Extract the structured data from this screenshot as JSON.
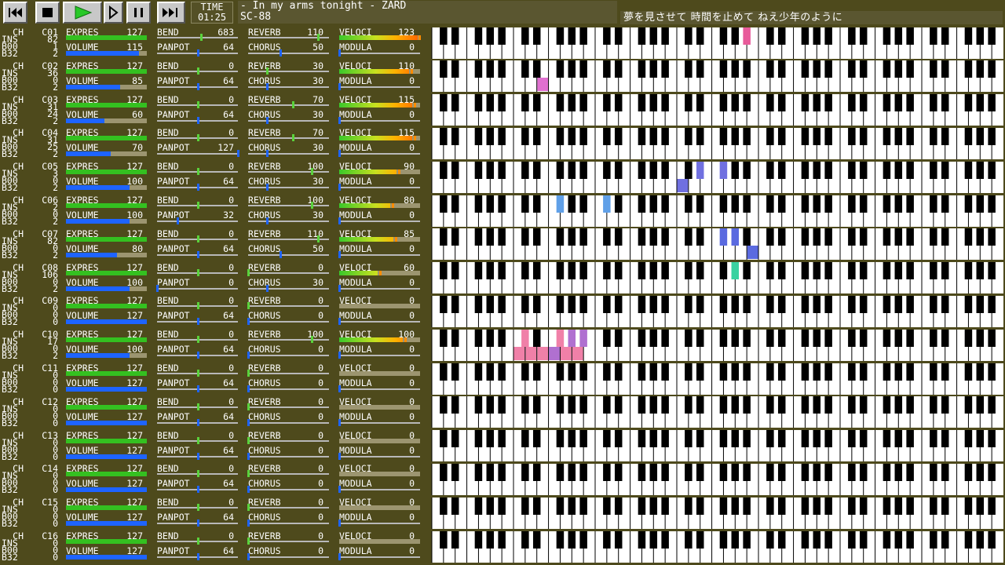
{
  "transport": {
    "buttons": [
      {
        "name": "rewind-button",
        "icon": "skip-back-icon"
      },
      {
        "name": "stop-button",
        "icon": "stop-icon"
      },
      {
        "name": "play-button",
        "icon": "play-icon"
      },
      {
        "name": "step-forward-button",
        "icon": "step-forward-icon"
      },
      {
        "name": "pause-button",
        "icon": "pause-icon"
      },
      {
        "name": "fast-forward-button",
        "icon": "skip-forward-icon"
      }
    ],
    "time_label": "TIME",
    "time_value": "01:25"
  },
  "song": {
    "title": "- In my arms tonight - ZARD",
    "module": "SC-88"
  },
  "lyric": "夢を見させて 時間を止めて ねえ少年のように",
  "labels": {
    "ch": "CH",
    "ins": "INS",
    "b00": "B00",
    "b32": "B32",
    "expres": "EXPRES",
    "volume": "VOLUME",
    "bend": "BEND",
    "panpot": "PANPOT",
    "reverb": "REVERB",
    "chorus": "CHORUS",
    "veloci": "VELOCI",
    "modula": "MODULA"
  },
  "colors": {
    "background": "#4e4a1c",
    "expression_bar": "#34c020",
    "volume_bar": "#1e64ff",
    "slider_thumb": "#5ad23c",
    "slider_thumb_blue": "#1e64ff"
  },
  "channels": [
    {
      "id": "C01",
      "ins": "82",
      "b00": "1",
      "b32": "2",
      "expres": "127",
      "volume": "115",
      "bend": "683",
      "panpot": "64",
      "reverb": "110",
      "chorus": "50",
      "veloci": "123",
      "modula": "0"
    },
    {
      "id": "C02",
      "ins": "36",
      "b00": "0",
      "b32": "2",
      "expres": "127",
      "volume": "85",
      "bend": "0",
      "panpot": "64",
      "reverb": "30",
      "chorus": "30",
      "veloci": "110",
      "modula": "0"
    },
    {
      "id": "C03",
      "ins": "31",
      "b00": "24",
      "b32": "2",
      "expres": "127",
      "volume": "60",
      "bend": "0",
      "panpot": "64",
      "reverb": "70",
      "chorus": "30",
      "veloci": "115",
      "modula": "0"
    },
    {
      "id": "C04",
      "ins": "31",
      "b00": "25",
      "b32": "2",
      "expres": "127",
      "volume": "70",
      "bend": "0",
      "panpot": "127",
      "reverb": "70",
      "chorus": "30",
      "veloci": "115",
      "modula": "0"
    },
    {
      "id": "C05",
      "ins": "3",
      "b00": "0",
      "b32": "2",
      "expres": "127",
      "volume": "100",
      "bend": "0",
      "panpot": "64",
      "reverb": "100",
      "chorus": "30",
      "veloci": "90",
      "modula": "0"
    },
    {
      "id": "C06",
      "ins": "2",
      "b00": "0",
      "b32": "2",
      "expres": "127",
      "volume": "100",
      "bend": "0",
      "panpot": "32",
      "reverb": "100",
      "chorus": "30",
      "veloci": "80",
      "modula": "0"
    },
    {
      "id": "C07",
      "ins": "82",
      "b00": "0",
      "b32": "2",
      "expres": "127",
      "volume": "80",
      "bend": "0",
      "panpot": "64",
      "reverb": "110",
      "chorus": "50",
      "veloci": "85",
      "modula": "0"
    },
    {
      "id": "C08",
      "ins": "106",
      "b00": "0",
      "b32": "2",
      "expres": "127",
      "volume": "100",
      "bend": "0",
      "panpot": "0",
      "reverb": "0",
      "chorus": "30",
      "veloci": "60",
      "modula": "0"
    },
    {
      "id": "C09",
      "ins": "0",
      "b00": "0",
      "b32": "0",
      "expres": "127",
      "volume": "127",
      "bend": "0",
      "panpot": "64",
      "reverb": "0",
      "chorus": "0",
      "veloci": "0",
      "modula": "0"
    },
    {
      "id": "C10",
      "ins": "17",
      "b00": "0",
      "b32": "2",
      "expres": "127",
      "volume": "100",
      "bend": "0",
      "panpot": "64",
      "reverb": "100",
      "chorus": "0",
      "veloci": "100",
      "modula": "0"
    },
    {
      "id": "C11",
      "ins": "0",
      "b00": "0",
      "b32": "0",
      "expres": "127",
      "volume": "127",
      "bend": "0",
      "panpot": "64",
      "reverb": "0",
      "chorus": "0",
      "veloci": "0",
      "modula": "0"
    },
    {
      "id": "C12",
      "ins": "0",
      "b00": "0",
      "b32": "0",
      "expres": "127",
      "volume": "127",
      "bend": "0",
      "panpot": "64",
      "reverb": "0",
      "chorus": "0",
      "veloci": "0",
      "modula": "0"
    },
    {
      "id": "C13",
      "ins": "0",
      "b00": "0",
      "b32": "0",
      "expres": "127",
      "volume": "127",
      "bend": "0",
      "panpot": "64",
      "reverb": "0",
      "chorus": "0",
      "veloci": "0",
      "modula": "0"
    },
    {
      "id": "C14",
      "ins": "0",
      "b00": "0",
      "b32": "0",
      "expres": "127",
      "volume": "127",
      "bend": "0",
      "panpot": "64",
      "reverb": "0",
      "chorus": "0",
      "veloci": "0",
      "modula": "0"
    },
    {
      "id": "C15",
      "ins": "0",
      "b00": "0",
      "b32": "0",
      "expres": "127",
      "volume": "127",
      "bend": "0",
      "panpot": "64",
      "reverb": "0",
      "chorus": "0",
      "veloci": "0",
      "modula": "0"
    },
    {
      "id": "C16",
      "ins": "0",
      "b00": "0",
      "b32": "0",
      "expres": "127",
      "volume": "127",
      "bend": "0",
      "panpot": "64",
      "reverb": "0",
      "chorus": "0",
      "veloci": "0",
      "modula": "0"
    }
  ],
  "active_notes": [
    {
      "ch": 1,
      "note": 70,
      "color": "#e85a9a"
    },
    {
      "ch": 2,
      "note": 40,
      "color": "#e070d0"
    },
    {
      "ch": 5,
      "note": 60,
      "color": "#7070e0"
    },
    {
      "ch": 5,
      "note": 63,
      "color": "#7070e0"
    },
    {
      "ch": 5,
      "note": 66,
      "color": "#7070e0"
    },
    {
      "ch": 6,
      "note": 42,
      "color": "#60a0e8"
    },
    {
      "ch": 6,
      "note": 49,
      "color": "#60a0e8"
    },
    {
      "ch": 7,
      "note": 66,
      "color": "#5a6ae0"
    },
    {
      "ch": 7,
      "note": 68,
      "color": "#5a6ae0"
    },
    {
      "ch": 7,
      "note": 71,
      "color": "#5a6ae0"
    },
    {
      "ch": 8,
      "note": 68,
      "color": "#3ad2a0"
    },
    {
      "ch": 10,
      "note": 36,
      "color": "#f080a8"
    },
    {
      "ch": 10,
      "note": 37,
      "color": "#f080a8"
    },
    {
      "ch": 10,
      "note": 38,
      "color": "#f080a8"
    },
    {
      "ch": 10,
      "note": 40,
      "color": "#f080a8"
    },
    {
      "ch": 10,
      "note": 41,
      "color": "#b070d0"
    },
    {
      "ch": 10,
      "note": 42,
      "color": "#f080a8"
    },
    {
      "ch": 10,
      "note": 43,
      "color": "#f080a8"
    },
    {
      "ch": 10,
      "note": 44,
      "color": "#b070d0"
    },
    {
      "ch": 10,
      "note": 45,
      "color": "#f080a8"
    },
    {
      "ch": 10,
      "note": 46,
      "color": "#b070d0"
    }
  ]
}
